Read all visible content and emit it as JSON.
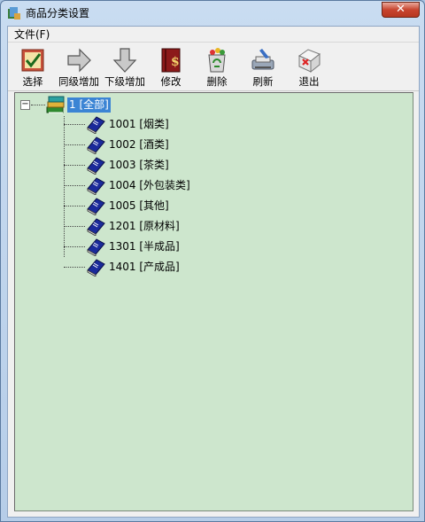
{
  "window": {
    "title": "商品分类设置",
    "close_glyph": "✕"
  },
  "menu": [
    {
      "label": "文件(F)"
    }
  ],
  "toolbar": [
    {
      "label": "选择",
      "icon": "select-check-icon"
    },
    {
      "label": "同级增加",
      "icon": "arrow-right-icon"
    },
    {
      "label": "下级增加",
      "icon": "arrow-down-icon"
    },
    {
      "label": "修改",
      "icon": "edit-book-icon"
    },
    {
      "label": "删除",
      "icon": "recycle-bin-icon"
    },
    {
      "label": "刷新",
      "icon": "refresh-printer-icon"
    },
    {
      "label": "退出",
      "icon": "exit-icon"
    }
  ],
  "tree": {
    "root": {
      "label": "1 [全部]",
      "expander": "−"
    },
    "children": [
      {
        "label": "1001 [烟类]"
      },
      {
        "label": "1002 [酒类]"
      },
      {
        "label": "1003 [茶类]"
      },
      {
        "label": "1004 [外包装类]"
      },
      {
        "label": "1005 [其他]"
      },
      {
        "label": "1201 [原材料]"
      },
      {
        "label": "1301 [半成品]"
      },
      {
        "label": "1401 [产成品]"
      }
    ]
  },
  "colors": {
    "tree_bg": "#cde6cd",
    "selection": "#3b84d4",
    "book_blue": "#1a2a9a"
  }
}
